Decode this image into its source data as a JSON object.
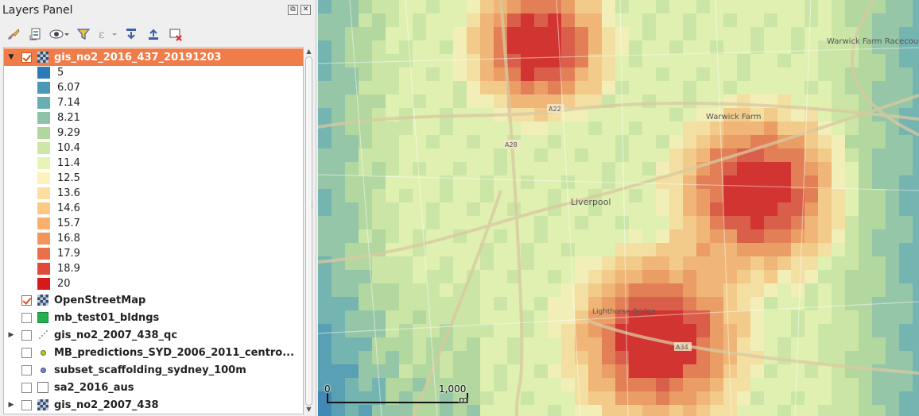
{
  "panel": {
    "title": "Layers Panel",
    "float_btn": "⧉",
    "close_btn": "✕"
  },
  "toolbar": {
    "buttons": [
      {
        "icon": "style-brush-icon"
      },
      {
        "icon": "add-group-icon"
      },
      {
        "icon": "eye-visibility-icon"
      },
      {
        "icon": "filter-icon"
      },
      {
        "icon": "expression-filter-icon"
      },
      {
        "icon": "expand-all-icon"
      },
      {
        "icon": "collapse-all-icon"
      },
      {
        "icon": "remove-layer-icon"
      }
    ]
  },
  "layers": [
    {
      "name": "gis_no2_2016_437_20191203",
      "checked": true,
      "expanded": true,
      "selected": true,
      "icon": "raster-icon"
    },
    {
      "name": "OpenStreetMap",
      "checked": true,
      "expanded": false,
      "selected": false,
      "icon": "raster-icon"
    },
    {
      "name": "mb_test01_bldngs",
      "checked": false,
      "expanded": false,
      "selected": false,
      "icon": "polygon-green-icon"
    },
    {
      "name": "gis_no2_2007_438_qc",
      "checked": false,
      "expanded": true,
      "selected": false,
      "icon": "point-cluster-icon"
    },
    {
      "name": "MB_predictions_SYD_2006_2011_centro...",
      "checked": false,
      "expanded": false,
      "selected": false,
      "icon": "point-yellow-icon"
    },
    {
      "name": "subset_scaffolding_sydney_100m",
      "checked": false,
      "expanded": false,
      "selected": false,
      "icon": "point-blue-icon"
    },
    {
      "name": "sa2_2016_aus",
      "checked": false,
      "expanded": false,
      "selected": false,
      "icon": "polygon-empty-icon"
    },
    {
      "name": "gis_no2_2007_438",
      "checked": false,
      "expanded": true,
      "selected": false,
      "icon": "raster-icon"
    }
  ],
  "legend": [
    {
      "label": "5",
      "color": "#2c7bb6"
    },
    {
      "label": "6.07",
      "color": "#4a97b6"
    },
    {
      "label": "7.14",
      "color": "#69aeb3"
    },
    {
      "label": "8.21",
      "color": "#8fc3a7"
    },
    {
      "label": "9.29",
      "color": "#b2d79e"
    },
    {
      "label": "10.4",
      "color": "#cfe7a6"
    },
    {
      "label": "11.4",
      "color": "#e8f4b3"
    },
    {
      "label": "12.5",
      "color": "#fdf2bb"
    },
    {
      "label": "13.6",
      "color": "#fde0a0"
    },
    {
      "label": "14.6",
      "color": "#fdc985"
    },
    {
      "label": "15.7",
      "color": "#f9b06e"
    },
    {
      "label": "16.8",
      "color": "#f3945a"
    },
    {
      "label": "17.9",
      "color": "#ea7049"
    },
    {
      "label": "18.9",
      "color": "#e04a3a"
    },
    {
      "label": "20",
      "color": "#d7191c"
    }
  ],
  "map": {
    "place_labels": [
      "Liverpool",
      "Warwick Farm",
      "Warwick Farm Racecourse",
      "Lighthorse Bridge"
    ],
    "road_labels": [
      "A22",
      "A28",
      "A34"
    ],
    "scalebar": {
      "start": "0",
      "end": "1,000",
      "unit": "m"
    }
  }
}
